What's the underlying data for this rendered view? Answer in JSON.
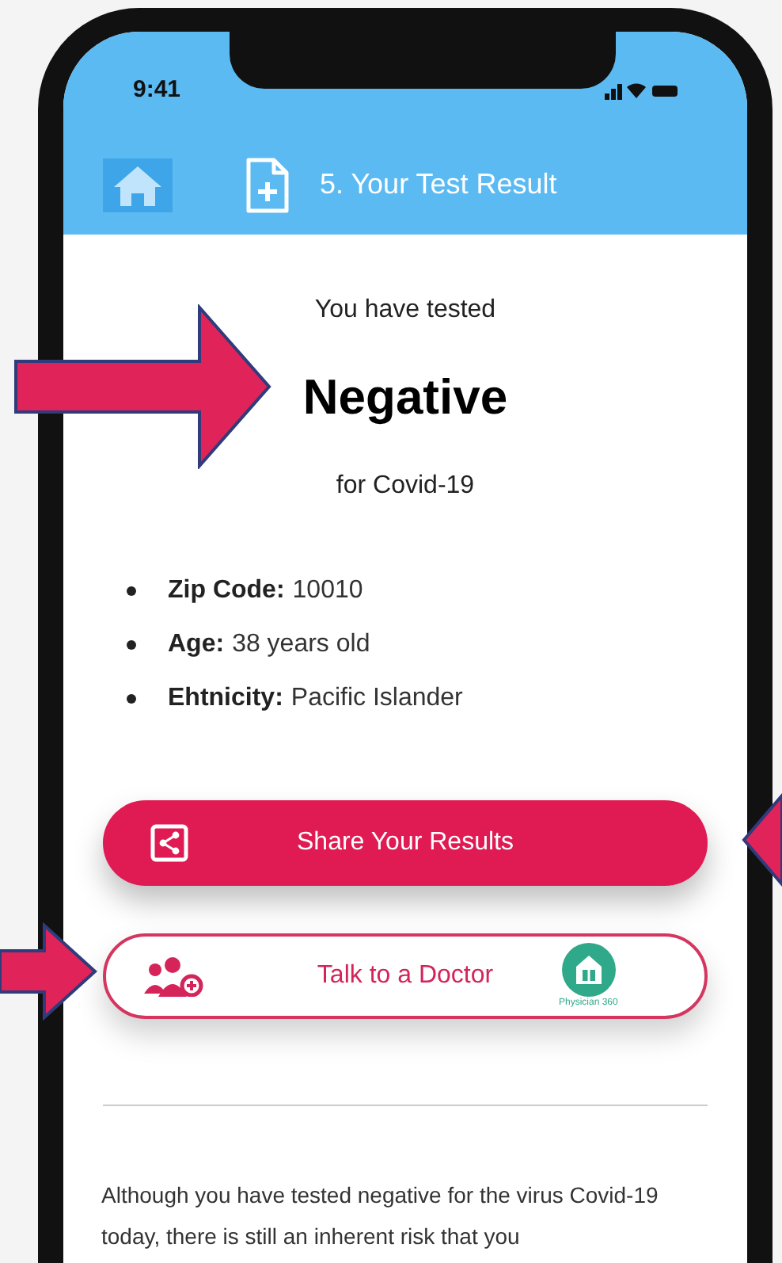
{
  "status_bar": {
    "time": "9:41"
  },
  "header": {
    "title": "5. Your Test Result"
  },
  "result": {
    "intro": "You have tested",
    "value": "Negative",
    "suffix": "for Covid-19"
  },
  "details": [
    {
      "label": "Zip Code:",
      "value": "10010"
    },
    {
      "label": "Age:",
      "value": "38 years old"
    },
    {
      "label": "Ehtnicity:",
      "value": "Pacific Islander"
    }
  ],
  "buttons": [
    {
      "kind": "share",
      "label": "Share Your Results"
    },
    {
      "kind": "doctor",
      "label": "Talk to a Doctor",
      "logo_caption": "Physician 360"
    }
  ],
  "notice": "Although you have tested negative for the virus Covid-19 today, there is still an inherent risk that you"
}
